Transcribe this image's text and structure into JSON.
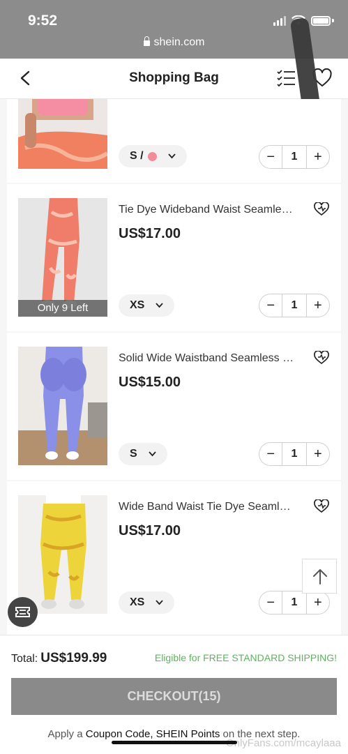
{
  "status_bar": {
    "time": "9:52",
    "url": "shein.com"
  },
  "header": {
    "title": "Shopping Bag"
  },
  "items": [
    {
      "title": "",
      "price": "",
      "size": "S /",
      "quantity": "1",
      "stock": "",
      "image_color": "#f07c6a"
    },
    {
      "title": "Tie Dye Wideband Waist Seamless Leggings",
      "price": "US$17.00",
      "size": "XS",
      "quantity": "1",
      "stock": "Only 9 Left",
      "image_color": "#f07c6a"
    },
    {
      "title": "Solid Wide Waistband Seamless Leggings",
      "price": "US$15.00",
      "size": "S",
      "quantity": "1",
      "stock": "",
      "image_color": "#8a8fe8"
    },
    {
      "title": "Wide Band Waist Tie Dye Seamless Leggings",
      "price": "US$17.00",
      "size": "XS",
      "quantity": "1",
      "stock": "",
      "image_color": "#ecd43a"
    }
  ],
  "footer": {
    "total_label": "Total:",
    "total_value": "US$199.99",
    "shipping_note": "Eligible for FREE STANDARD SHIPPING!",
    "checkout_label": "CHECKOUT(15)",
    "promo_prefix": "Apply a",
    "promo_links": "Coupon Code, SHEIN Points",
    "promo_suffix": "on the next step."
  },
  "watermark": "OnlyFans.com/mcaylaaa",
  "colors": {
    "shipping": "#5fb35f",
    "checkout_bg": "#8a8a8a",
    "status_bar": "#8c8c8c"
  }
}
